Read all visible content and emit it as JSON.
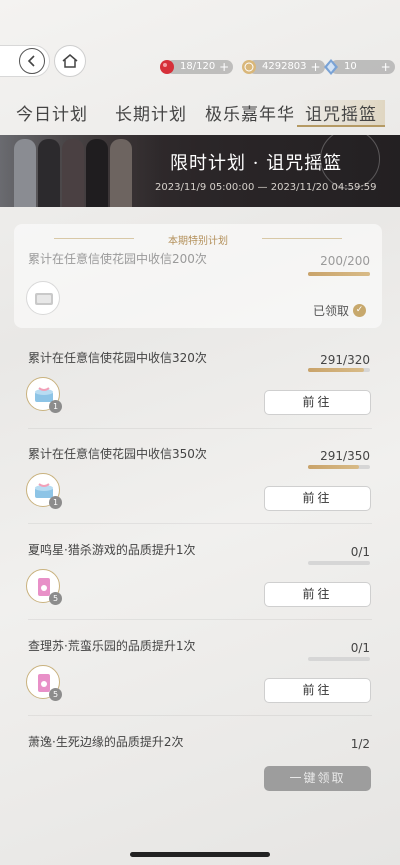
{
  "resources": [
    {
      "icon": "red-gem-icon",
      "value": "18/120",
      "color": "#d6303a"
    },
    {
      "icon": "gold-coin-icon",
      "value": "4292803",
      "color": "#d9b77a"
    },
    {
      "icon": "blue-crystal-icon",
      "value": "10",
      "color": "#7aa3d6"
    }
  ],
  "tabs": [
    "今日计划",
    "长期计划",
    "极乐嘉年华",
    "诅咒摇篮"
  ],
  "active_tab": "诅咒摇篮",
  "banner": {
    "title": "限时计划 · 诅咒摇篮",
    "date_range": "2023/11/9 05:00:00 — 2023/11/20 04:59:59"
  },
  "special": {
    "header": "本期特别计划",
    "task": "累计在任意信使花园中收信200次",
    "progress": "200/200",
    "progress_fraction": 1.0,
    "status": "已领取"
  },
  "tasks": [
    {
      "title": "累计在任意信使花园中收信320次",
      "progress": "291/320",
      "progress_fraction": 0.91,
      "reward_count": "1",
      "action": "前往"
    },
    {
      "title": "累计在任意信使花园中收信350次",
      "progress": "291/350",
      "progress_fraction": 0.83,
      "reward_count": "1",
      "action": "前往"
    },
    {
      "title": "夏鸣星·猎杀游戏的品质提升1次",
      "progress": "0/1",
      "progress_fraction": 0,
      "reward_count": "5",
      "action": "前往"
    },
    {
      "title": "查理苏·荒蛮乐园的品质提升1次",
      "progress": "0/1",
      "progress_fraction": 0,
      "reward_count": "5",
      "action": "前往"
    },
    {
      "title": "萧逸·生死边缘的品质提升2次",
      "progress": "1/2"
    }
  ],
  "claim_all": "一键领取"
}
